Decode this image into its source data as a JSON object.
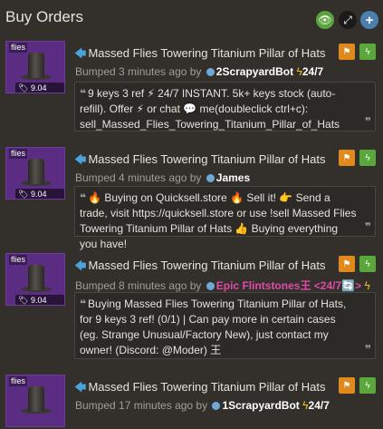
{
  "header": {
    "title": "Buy Orders"
  },
  "icons": {
    "eye": "eye-icon",
    "expand": "expand-icon",
    "plus": "plus-icon"
  },
  "listings": [
    {
      "thumb_label": "flies",
      "price": "9.04 keys",
      "name": "Massed Flies Towering Titanium Pillar of Hats",
      "bumped_prefix": "Bumped 3 minutes ago by",
      "user": "2ScrapyardBot",
      "user_suffix": "24/7",
      "comment": "9 keys 3 ref ⚡ 24/7 INSTANT. 5k+ keys stock (auto-refill). Offer ⚡ or chat 💬 me(doubleclick ctrl+c): sell_Massed_Flies_Towering_Titanium_Pillar_of_Hats"
    },
    {
      "thumb_label": "flies",
      "price": "9.04 keys",
      "name": "Massed Flies Towering Titanium Pillar of Hats",
      "bumped_prefix": "Bumped 4 minutes ago by",
      "user": "James",
      "user_suffix": "",
      "comment": "🔥 Buying on Quicksell.store 🔥 Sell it! 👉 Send a trade, visit https://quicksell.store or use !sell Massed Flies Towering Titanium Pillar of Hats 👍 Buying everything you have!"
    },
    {
      "thumb_label": "flies",
      "price": "9.04 keys",
      "name": "Massed Flies Towering Titanium Pillar of Hats",
      "bumped_prefix": "Bumped 8 minutes ago by",
      "user": "Epic Flintstones王 <24/7🔄>",
      "user_suffix": "",
      "comment": "Buying Massed Flies Towering Titanium Pillar of Hats, for 9 keys 3 ref! (0/1) | Can pay more in certain cases (eg. Strange Unusual/Factory New), just contact my owner! (Discord: @Moder) 王"
    },
    {
      "thumb_label": "flies",
      "price": "9.04 keys",
      "name": "Massed Flies Towering Titanium Pillar of Hats",
      "bumped_prefix": "Bumped 17 minutes ago by",
      "user": "1ScrapyardBot",
      "user_suffix": "24/7",
      "comment": ""
    }
  ]
}
